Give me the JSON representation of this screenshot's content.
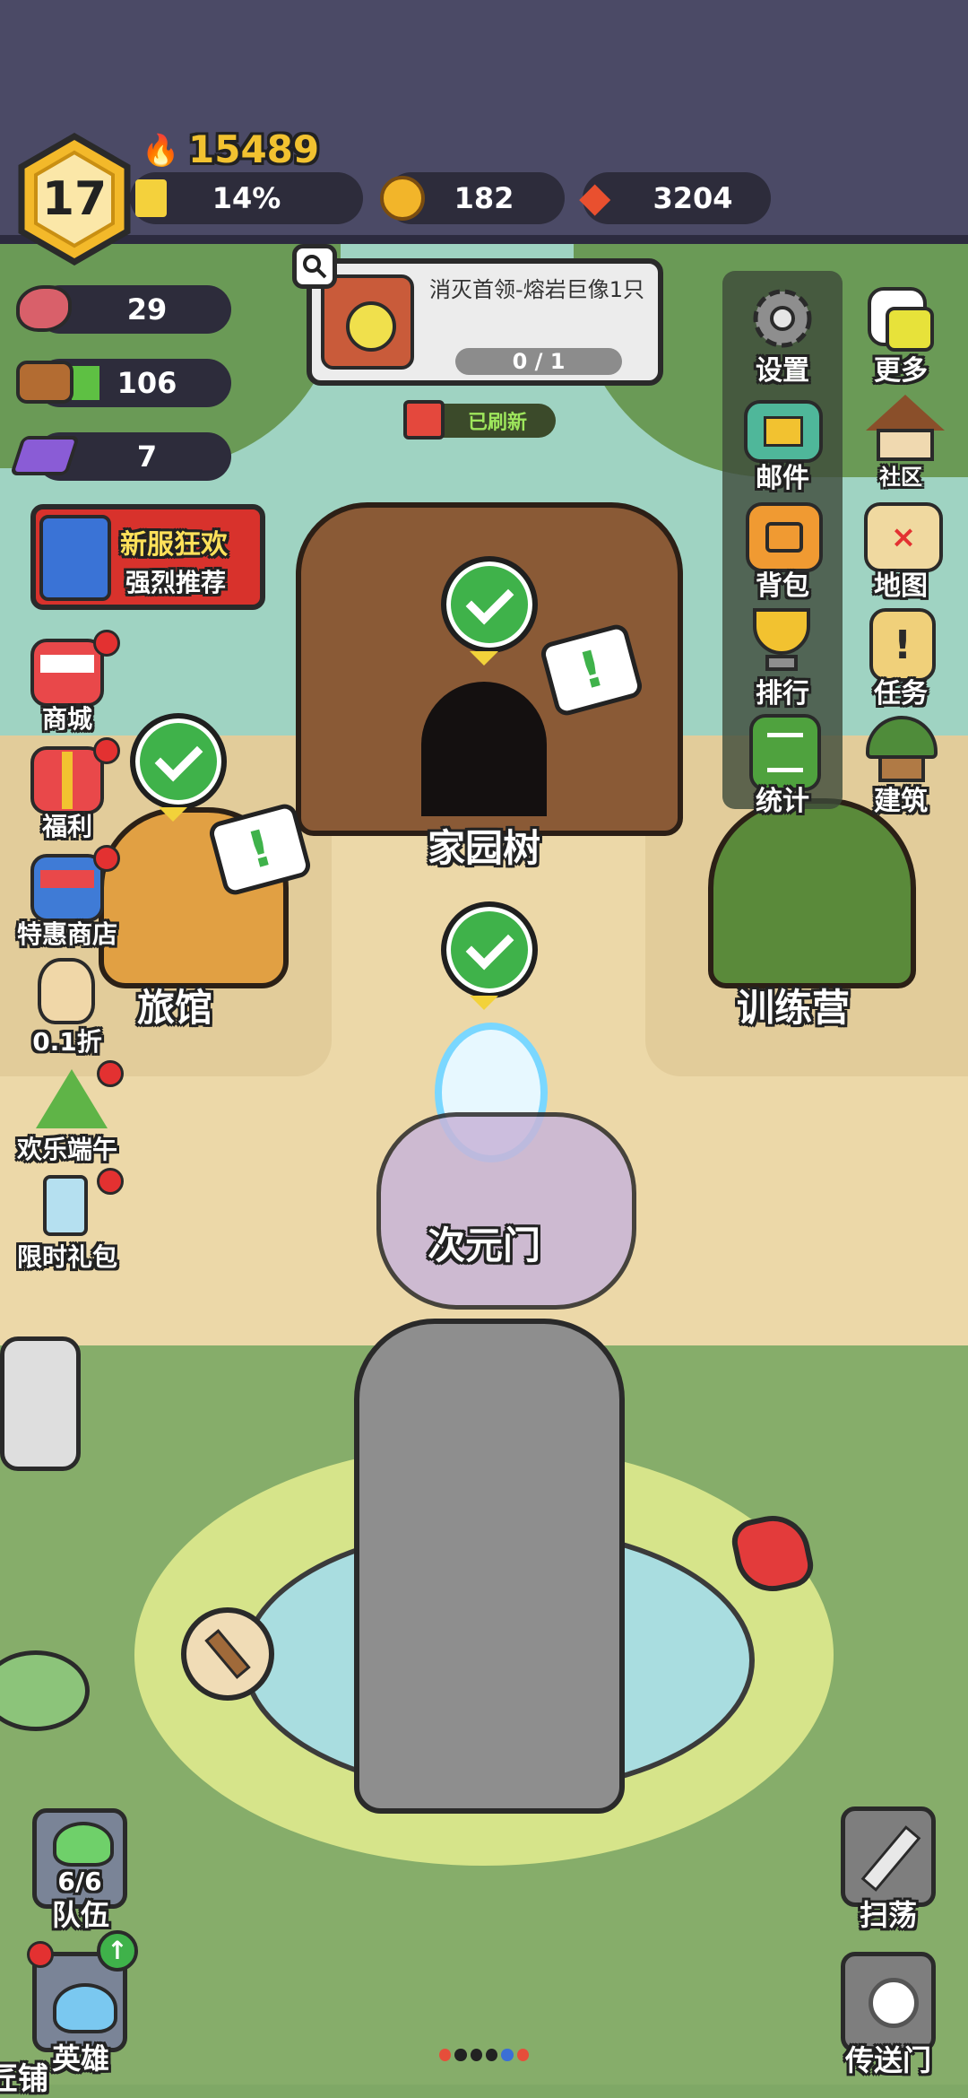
{
  "player": {
    "level": "17",
    "power": "15489",
    "exp_percent": "14%",
    "exp_fraction": 0.14
  },
  "currencies": {
    "gold": "182",
    "gems": "3204"
  },
  "resources": {
    "meat": "29",
    "wood": "106",
    "crystal": "7",
    "wood_fill": 0.18
  },
  "quest": {
    "title": "消灭首领-熔岩巨像1只",
    "progress": "0 / 1",
    "refresh_label": "已刷新"
  },
  "promo_banner": {
    "line1": "新服狂欢",
    "line2": "强烈推荐"
  },
  "left_menu": [
    {
      "label": "商城",
      "icon": "shop-icon"
    },
    {
      "label": "福利",
      "icon": "gift-icon"
    },
    {
      "label": "特惠商店",
      "icon": "sale-shop-icon"
    },
    {
      "label": "0.1折",
      "icon": "discount-rabbit-icon"
    },
    {
      "label": "欢乐端午",
      "icon": "zongzi-icon"
    },
    {
      "label": "限时礼包",
      "icon": "hourglass-icon"
    }
  ],
  "right_menu": [
    {
      "label": "设置",
      "icon": "gear-icon"
    },
    {
      "label": "更多",
      "icon": "more-cards-icon"
    },
    {
      "label": "邮件",
      "icon": "mail-icon"
    },
    {
      "label": "社区",
      "icon": "house-icon"
    },
    {
      "label": "背包",
      "icon": "backpack-icon"
    },
    {
      "label": "地图",
      "icon": "map-icon"
    },
    {
      "label": "排行",
      "icon": "trophy-icon"
    },
    {
      "label": "任务",
      "icon": "quest-scroll-icon"
    },
    {
      "label": "统计",
      "icon": "book-icon"
    },
    {
      "label": "建筑",
      "icon": "building-icon"
    }
  ],
  "locations": {
    "home_tree": "家园树",
    "inn": "旅馆",
    "training": "训练营",
    "portal": "次元门"
  },
  "bottom_left": {
    "team_label": "队伍",
    "team_count": "6/6",
    "hero_label": "英雄",
    "smith_label": "匠铺"
  },
  "bottom_right": {
    "sweep_label": "扫荡",
    "portal_label": "传送门"
  },
  "colors": {
    "accent_gold": "#f2c230",
    "top_bar": "#4b4a66",
    "grass": "#7fa866",
    "path": "#ecd8a8"
  }
}
